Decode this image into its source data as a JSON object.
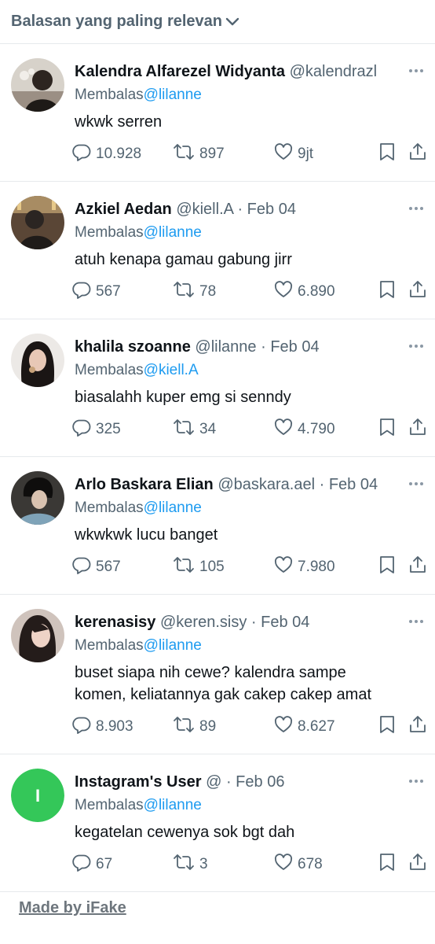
{
  "header": {
    "title": "Balasan yang paling relevan"
  },
  "reply_prefix": "Membalas",
  "tweets": [
    {
      "name": "Kalendra Alfarezel Widyanta",
      "handle": "@kalendrazl",
      "dot": "",
      "date": "",
      "reply_to": "@lilanne",
      "text": "wkwk serren",
      "replies": "10.928",
      "retweets": "897",
      "likes": "9jt"
    },
    {
      "name": "Azkiel Aedan",
      "handle": "@kiell.A",
      "dot": "·",
      "date": "Feb 04",
      "reply_to": "@lilanne",
      "text": "atuh kenapa gamau gabung jirr",
      "replies": "567",
      "retweets": "78",
      "likes": "6.890"
    },
    {
      "name": "khalila szoanne",
      "handle": "@lilanne",
      "dot": "·",
      "date": "Feb 04",
      "reply_to": "@kiell.A",
      "text": "biasalahh kuper emg si senndy",
      "replies": "325",
      "retweets": "34",
      "likes": "4.790"
    },
    {
      "name": "Arlo Baskara Elian",
      "handle": "@baskara.ael",
      "dot": "·",
      "date": "Feb 04",
      "reply_to": "@lilanne",
      "text": "wkwkwk lucu banget",
      "replies": "567",
      "retweets": "105",
      "likes": "7.980"
    },
    {
      "name": "kerenasisy",
      "handle": "@keren.sisy",
      "dot": "·",
      "date": "Feb 04",
      "reply_to": "@lilanne",
      "text": "buset siapa nih cewe? kalendra sampe\nkomen, keliatannya gak cakep cakep amat",
      "replies": "8.903",
      "retweets": "89",
      "likes": "8.627"
    },
    {
      "name": "Instagram's User",
      "handle": "@",
      "dot": "·",
      "date": "Feb 06",
      "reply_to": "@lilanne",
      "text": "kegatelan cewenya sok bgt dah",
      "replies": "67",
      "retweets": "3",
      "likes": "678",
      "avatar_letter": "I"
    }
  ],
  "footer": {
    "label": "Made by iFake"
  },
  "colors": {
    "accent": "#1d9bf0",
    "secondary_text": "#536471",
    "avatar_green": "#34c759"
  }
}
